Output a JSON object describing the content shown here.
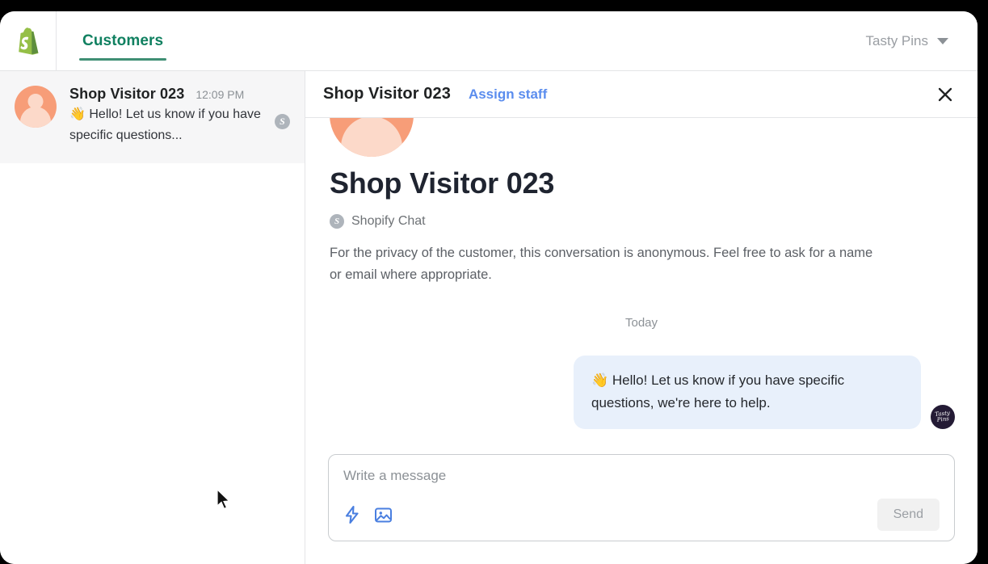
{
  "topbar": {
    "logo_icon": "shopify-bag-icon",
    "tabs": [
      {
        "label": "Customers",
        "active": true
      }
    ],
    "store_switcher": {
      "label": "Tasty Pins",
      "caret_icon": "chevron-down-icon"
    }
  },
  "sidebar": {
    "conversations": [
      {
        "name": "Shop Visitor 023",
        "time": "12:09 PM",
        "preview": "👋 Hello! Let us know if you have specific questions...",
        "channel_badge": "S",
        "avatar_icon": "person-avatar-icon",
        "selected": true
      }
    ]
  },
  "conversation": {
    "header": {
      "title": "Shop Visitor 023",
      "assign_label": "Assign staff",
      "close_icon": "close-icon"
    },
    "profile": {
      "avatar_icon": "person-avatar-icon",
      "name": "Shop Visitor 023",
      "channel_badge": "S",
      "channel_label": "Shopify Chat",
      "privacy_note": "For the privacy of the customer, this conversation is anonymous. Feel free to ask for a name or email where appropriate."
    },
    "day_divider": "Today",
    "messages": [
      {
        "text": "👋 Hello! Let us know if you have specific questions, we're here to help.",
        "from": "store",
        "avatar_text": "Tasty Pins"
      }
    ],
    "composer": {
      "value": "",
      "placeholder": "Write a message",
      "quick_reply_icon": "lightning-bolt-icon",
      "image_icon": "image-icon",
      "send_label": "Send",
      "send_disabled": true
    }
  },
  "colors": {
    "accent_green": "#3f8f74",
    "link_blue": "#5b8dee",
    "bubble_blue": "#e8f0fb",
    "avatar_peach": "#f79d78",
    "brand_dark": "#241b35"
  }
}
